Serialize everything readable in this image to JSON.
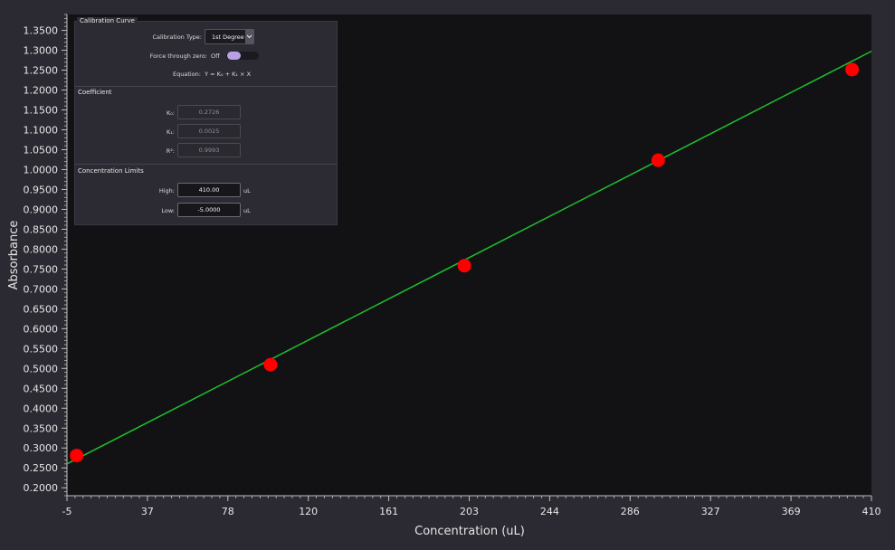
{
  "panel": {
    "calibration_title": "Calibration Curve",
    "calibration_type_label": "Calibration Type:",
    "calibration_type_value": "1st Degree",
    "force_zero_label": "Force through zero:",
    "force_zero_value": "Off",
    "equation_label": "Equation:",
    "equation_text": "Y = K₀ + K₁ × X",
    "coefficient_title": "Coefficient",
    "k0_label": "K₀:",
    "k0_value": "0.2726",
    "k1_label": "K₁:",
    "k1_value": "0.0025",
    "r2_label": "R²:",
    "r2_value": "0.9993",
    "limits_title": "Concentration Limits",
    "high_label": "High:",
    "high_value": "410.00",
    "high_unit": "uL",
    "low_label": "Low:",
    "low_value": "-5.0000",
    "low_unit": "uL"
  },
  "colors": {
    "background": "#2b2a33",
    "plot_background": "#121214",
    "line": "#1fbf2f",
    "points": "#ff0000",
    "axis": "#bdbdbd"
  },
  "chart_data": {
    "type": "scatter",
    "xlabel": "Concentration (uL)",
    "ylabel": "Absorbance",
    "xlim": [
      -5,
      410
    ],
    "ylim": [
      0.18,
      1.39
    ],
    "x_ticks": [
      "-5",
      "37",
      "78",
      "120",
      "161",
      "203",
      "244",
      "286",
      "327",
      "369",
      "410"
    ],
    "y_ticks": [
      "0.2000",
      "0.2500",
      "0.3000",
      "0.3500",
      "0.4000",
      "0.4500",
      "0.5000",
      "0.5500",
      "0.6000",
      "0.6500",
      "0.7000",
      "0.7500",
      "0.8000",
      "0.8500",
      "0.9000",
      "0.9500",
      "1.0000",
      "1.0500",
      "1.1000",
      "1.1500",
      "1.2000",
      "1.2500",
      "1.3000",
      "1.3500"
    ],
    "points": [
      {
        "x": 0,
        "y": 0.281
      },
      {
        "x": 100,
        "y": 0.5095
      },
      {
        "x": 200,
        "y": 0.7585
      },
      {
        "x": 300,
        "y": 1.0235
      },
      {
        "x": 400,
        "y": 1.2515
      }
    ],
    "fit_line": {
      "x": [
        -5,
        410
      ],
      "y": [
        0.26,
        1.2976
      ]
    },
    "grid": false,
    "legend": "none"
  }
}
